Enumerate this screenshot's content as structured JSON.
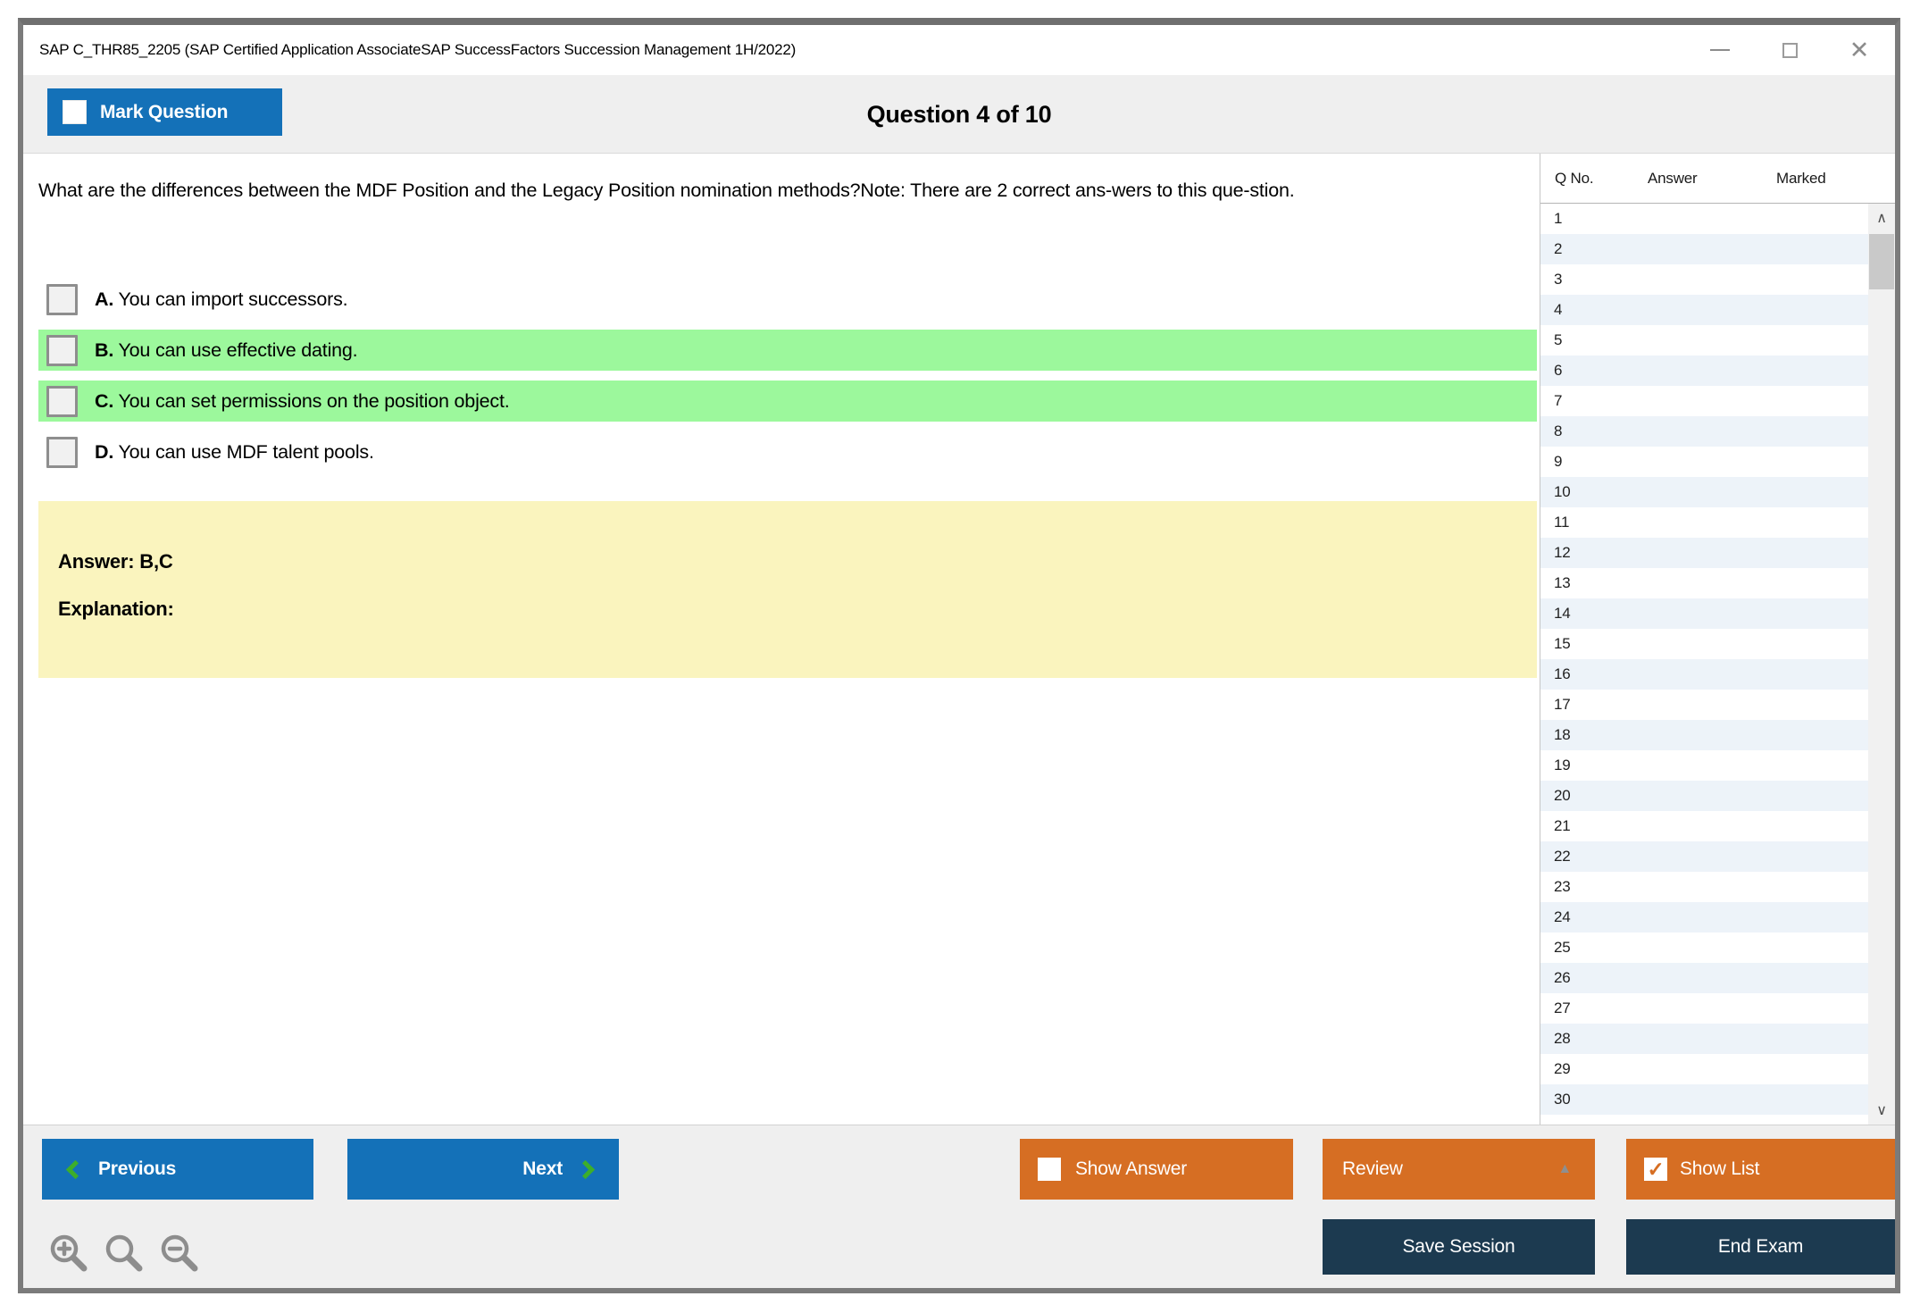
{
  "colors": {
    "blue": "#1471b8",
    "orange": "#d66e23",
    "navy": "#1c3a50",
    "green": "#9cf89c",
    "yellow": "#faf4be",
    "row_alt": "#edf3f9",
    "chevron_green": "#3dae2b"
  },
  "window": {
    "title": "SAP C_THR85_2205 (SAP Certified Application AssociateSAP SuccessFactors Succession Management 1H/2022)"
  },
  "icons": {
    "minimize": "minimize-bar",
    "maximize": "maximize-square",
    "close": "✕",
    "review_caret": "▲",
    "check_glyph": "✓",
    "scroll_up": "∧",
    "scroll_down": "∨",
    "previous_chevron": "css-chevron-left",
    "next_chevron": "css-chevron-right",
    "zoom_tools": [
      "magnifier-plus",
      "magnifier",
      "magnifier-minus"
    ]
  },
  "header": {
    "mark_question": "Mark Question",
    "counter": "Question 4 of 10"
  },
  "question": {
    "text": "What are the differences between the MDF Position and the Legacy Position nomination methods?Note: There are 2 correct ans-wers to this que-stion.",
    "options": [
      {
        "letter": "A.",
        "text": "You can import successors.",
        "highlighted": false
      },
      {
        "letter": "B.",
        "text": "You can use effective dating.",
        "highlighted": true
      },
      {
        "letter": "C.",
        "text": "You can set permissions on the position object.",
        "highlighted": true
      },
      {
        "letter": "D.",
        "text": "You can use MDF talent pools.",
        "highlighted": false
      }
    ]
  },
  "answer_panel": {
    "answer": "Answer: B,C",
    "explanation": "Explanation:"
  },
  "question_list": {
    "columns": [
      "Q No.",
      "Answer",
      "Marked"
    ],
    "rows": [
      {
        "q": "1",
        "answer": "",
        "marked": ""
      },
      {
        "q": "2",
        "answer": "",
        "marked": ""
      },
      {
        "q": "3",
        "answer": "",
        "marked": ""
      },
      {
        "q": "4",
        "answer": "",
        "marked": ""
      },
      {
        "q": "5",
        "answer": "",
        "marked": ""
      },
      {
        "q": "6",
        "answer": "",
        "marked": ""
      },
      {
        "q": "7",
        "answer": "",
        "marked": ""
      },
      {
        "q": "8",
        "answer": "",
        "marked": ""
      },
      {
        "q": "9",
        "answer": "",
        "marked": ""
      },
      {
        "q": "10",
        "answer": "",
        "marked": ""
      },
      {
        "q": "11",
        "answer": "",
        "marked": ""
      },
      {
        "q": "12",
        "answer": "",
        "marked": ""
      },
      {
        "q": "13",
        "answer": "",
        "marked": ""
      },
      {
        "q": "14",
        "answer": "",
        "marked": ""
      },
      {
        "q": "15",
        "answer": "",
        "marked": ""
      },
      {
        "q": "16",
        "answer": "",
        "marked": ""
      },
      {
        "q": "17",
        "answer": "",
        "marked": ""
      },
      {
        "q": "18",
        "answer": "",
        "marked": ""
      },
      {
        "q": "19",
        "answer": "",
        "marked": ""
      },
      {
        "q": "20",
        "answer": "",
        "marked": ""
      },
      {
        "q": "21",
        "answer": "",
        "marked": ""
      },
      {
        "q": "22",
        "answer": "",
        "marked": ""
      },
      {
        "q": "23",
        "answer": "",
        "marked": ""
      },
      {
        "q": "24",
        "answer": "",
        "marked": ""
      },
      {
        "q": "25",
        "answer": "",
        "marked": ""
      },
      {
        "q": "26",
        "answer": "",
        "marked": ""
      },
      {
        "q": "27",
        "answer": "",
        "marked": ""
      },
      {
        "q": "28",
        "answer": "",
        "marked": ""
      },
      {
        "q": "29",
        "answer": "",
        "marked": ""
      },
      {
        "q": "30",
        "answer": "",
        "marked": ""
      }
    ]
  },
  "footer": {
    "previous": "Previous",
    "next": "Next",
    "show_answer": "Show Answer",
    "review": "Review",
    "show_list": "Show List",
    "save_session": "Save Session",
    "end_exam": "End Exam"
  }
}
